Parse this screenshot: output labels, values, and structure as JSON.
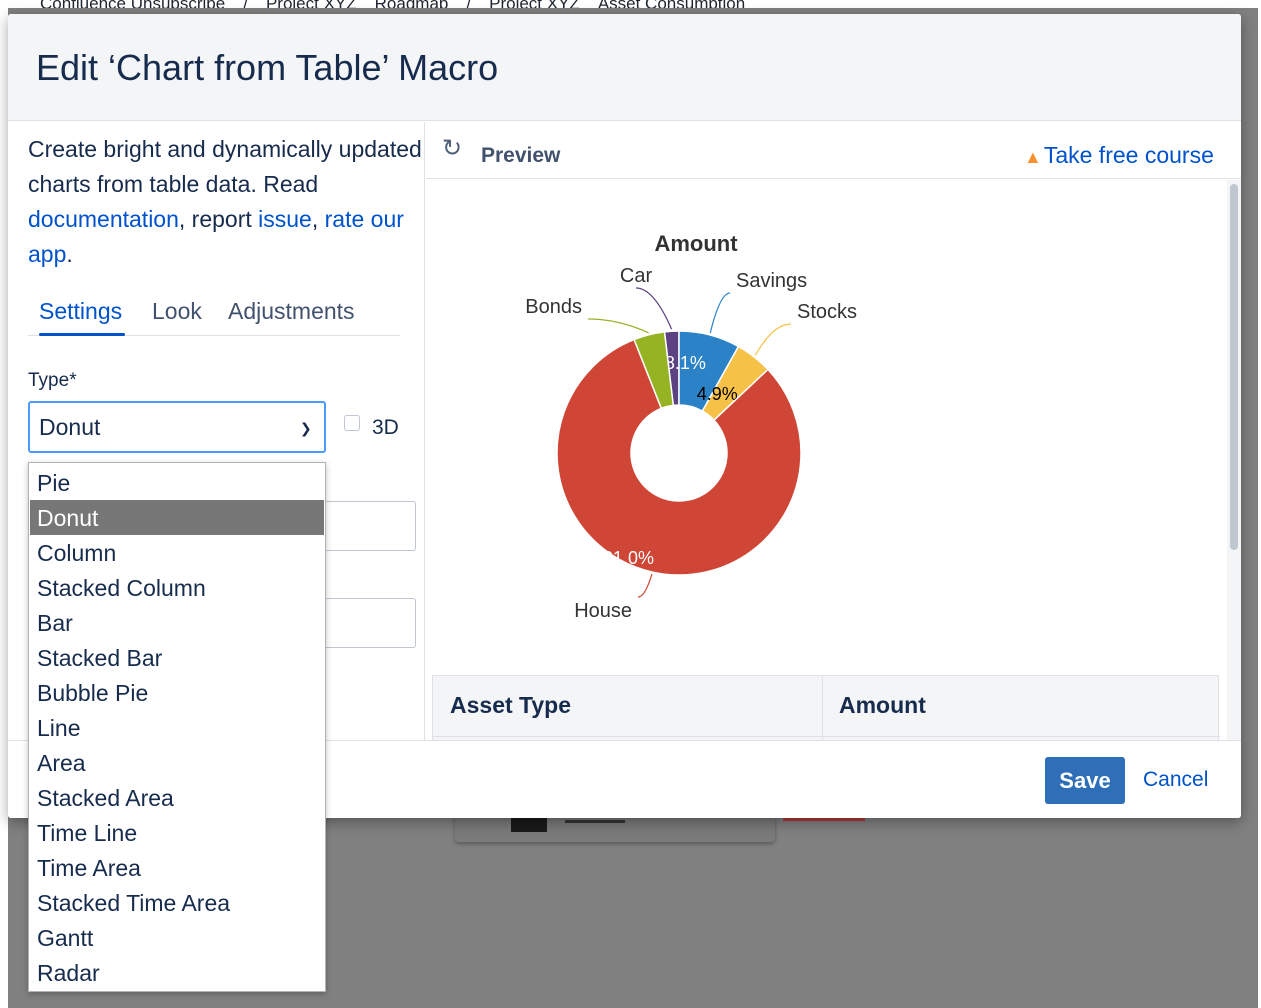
{
  "breadcrumb": [
    "Confluence Unsubscribe",
    "/",
    "Project XYZ",
    "Roadmap",
    "/",
    "Project XYZ",
    "Asset Consumption"
  ],
  "dialog": {
    "title": "Edit ‘Chart from Table’ Macro",
    "intro_text": "Create bright and dynamically updated charts from table data. Read",
    "link_documentation": "documentation",
    "text_report": ", report",
    "link_issue": "issue",
    "text_comma": ",",
    "link_rate": "rate our app",
    "text_period": ".",
    "tabs": [
      "Settings",
      "Look",
      "Adjustments"
    ],
    "active_tab": "Settings",
    "type_label": "Type*",
    "type_value": "Donut",
    "checkbox_3d_label": "3D",
    "checkbox_3d_checked": false,
    "type_options": [
      "Pie",
      "Donut",
      "Column",
      "Stacked Column",
      "Bar",
      "Stacked Bar",
      "Bubble Pie",
      "Line",
      "Area",
      "Stacked Area",
      "Time Line",
      "Time Area",
      "Stacked Time Area",
      "Gantt",
      "Radar"
    ],
    "preview_label": "Preview",
    "course_link": "Take free course",
    "table_headers": [
      "Asset Type",
      "Amount"
    ],
    "save_label": "Save",
    "cancel_label": "Cancel"
  },
  "icons": {
    "refresh": "refresh-icon",
    "course": "graduation-cap-icon",
    "dropdown": "chevron-down-icon"
  },
  "colors": {
    "accent": "#0052cc",
    "save_button": "#2e6fb7",
    "House": "#cf4536",
    "Bonds": "#96b324",
    "Car": "#5c4183",
    "Savings": "#2b82c7",
    "Stocks": "#f5c147"
  },
  "chart_data": {
    "type": "pie",
    "variant": "donut",
    "title": "Amount",
    "slices": [
      {
        "label": "Car",
        "percent": 1.9,
        "color": "#5c4183",
        "data_label": ""
      },
      {
        "label": "Savings",
        "percent": 8.1,
        "color": "#2b82c7",
        "data_label": "8.1%"
      },
      {
        "label": "Stocks",
        "percent": 4.9,
        "color": "#f5c147",
        "data_label": "4.9%"
      },
      {
        "label": "House",
        "percent": 81.0,
        "color": "#cf4536",
        "data_label": "81.0%"
      },
      {
        "label": "Bonds",
        "percent": 4.1,
        "color": "#96b324",
        "data_label": ""
      }
    ]
  }
}
